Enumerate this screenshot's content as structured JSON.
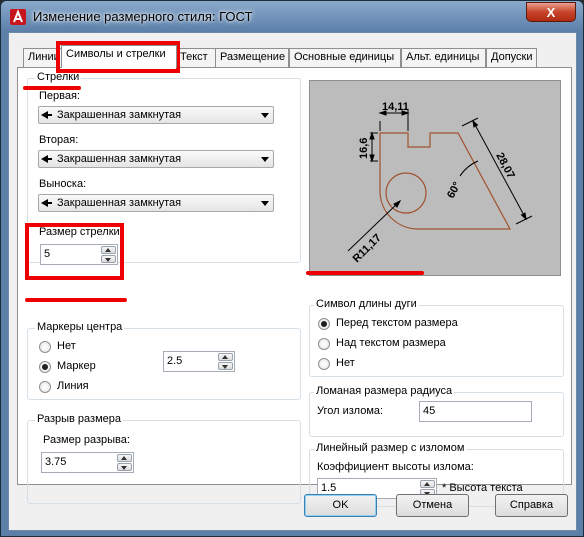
{
  "window": {
    "title": "Изменение размерного стиля: ГОСТ",
    "close_label": "X"
  },
  "tabs": [
    {
      "label": "Линии"
    },
    {
      "label": "Символы и стрелки"
    },
    {
      "label": "Текст"
    },
    {
      "label": "Размещение"
    },
    {
      "label": "Основные единицы"
    },
    {
      "label": "Альт. единицы"
    },
    {
      "label": "Допуски"
    }
  ],
  "arrows": {
    "title": "Стрелки",
    "first_label": "Первая:",
    "first_value": "Закрашенная замкнутая",
    "second_label": "Вторая:",
    "second_value": "Закрашенная замкнутая",
    "leader_label": "Выноска:",
    "leader_value": "Закрашенная замкнутая",
    "size_label": "Размер стрелки",
    "size_value": "5"
  },
  "center_marks": {
    "title": "Маркеры центра",
    "options": [
      "Нет",
      "Маркер",
      "Линия"
    ],
    "selected": "Маркер",
    "size_value": "2.5"
  },
  "dim_break": {
    "title": "Разрыв размера",
    "size_label": "Размер разрыва:",
    "size_value": "3.75"
  },
  "preview": {
    "dim1": "14,11",
    "dim2": "16,6",
    "dim3": "28,07",
    "dim4": "60°",
    "dim5": "R11,17"
  },
  "arc_length": {
    "title": "Символ длины дуги",
    "options": [
      "Перед текстом размера",
      "Над текстом размера",
      "Нет"
    ],
    "selected": "Перед текстом размера"
  },
  "radius_jog": {
    "title": "Ломаная размера радиуса",
    "angle_label": "Угол излома:",
    "angle_value": "45"
  },
  "linear_jog": {
    "title": "Линейный размер с изломом",
    "factor_label": "Коэффициент высоты излома:",
    "factor_value": "1.5",
    "factor_suffix": "* Высота текста"
  },
  "buttons": {
    "ok": "OK",
    "cancel": "Отмена",
    "help": "Справка"
  },
  "colors": {
    "annotation": "#ee0000",
    "preview_bg": "#bcbcbc",
    "geometry": "#a0522d"
  }
}
